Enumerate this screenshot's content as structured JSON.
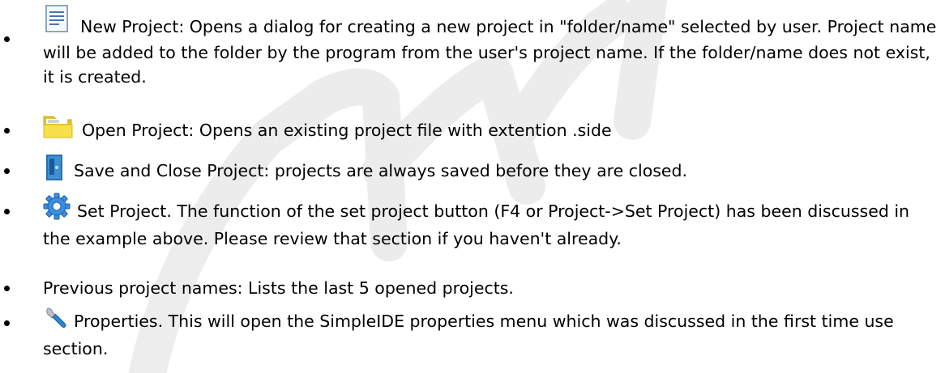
{
  "items": [
    {
      "icon": "new-project-icon",
      "text": "New Project: Opens a dialog for creating a new project in \"folder/name\" selected by user. Project name will be added to the folder by the program from the user's project name. If the folder/name does not exist, it is created."
    },
    {
      "icon": "open-project-icon",
      "text": "Open Project: Opens an existing project file with extention .side"
    },
    {
      "icon": "save-close-project-icon",
      "text": "Save and Close Project: projects are always saved before they are closed."
    },
    {
      "icon": "set-project-gear-icon",
      "text": "Set Project. The function of the set project button (F4 or Project->Set Project) has been discussed in the example above. Please review that section if you haven't already."
    },
    {
      "icon": "",
      "text": "Previous project names: Lists the last 5 opened projects."
    },
    {
      "icon": "properties-wrench-icon",
      "text": "Properties. This will open the SimpleIDE properties menu which was discussed in the first time use section."
    }
  ],
  "colors": {
    "text": "#000000",
    "watermark": "#e6e6e6"
  }
}
